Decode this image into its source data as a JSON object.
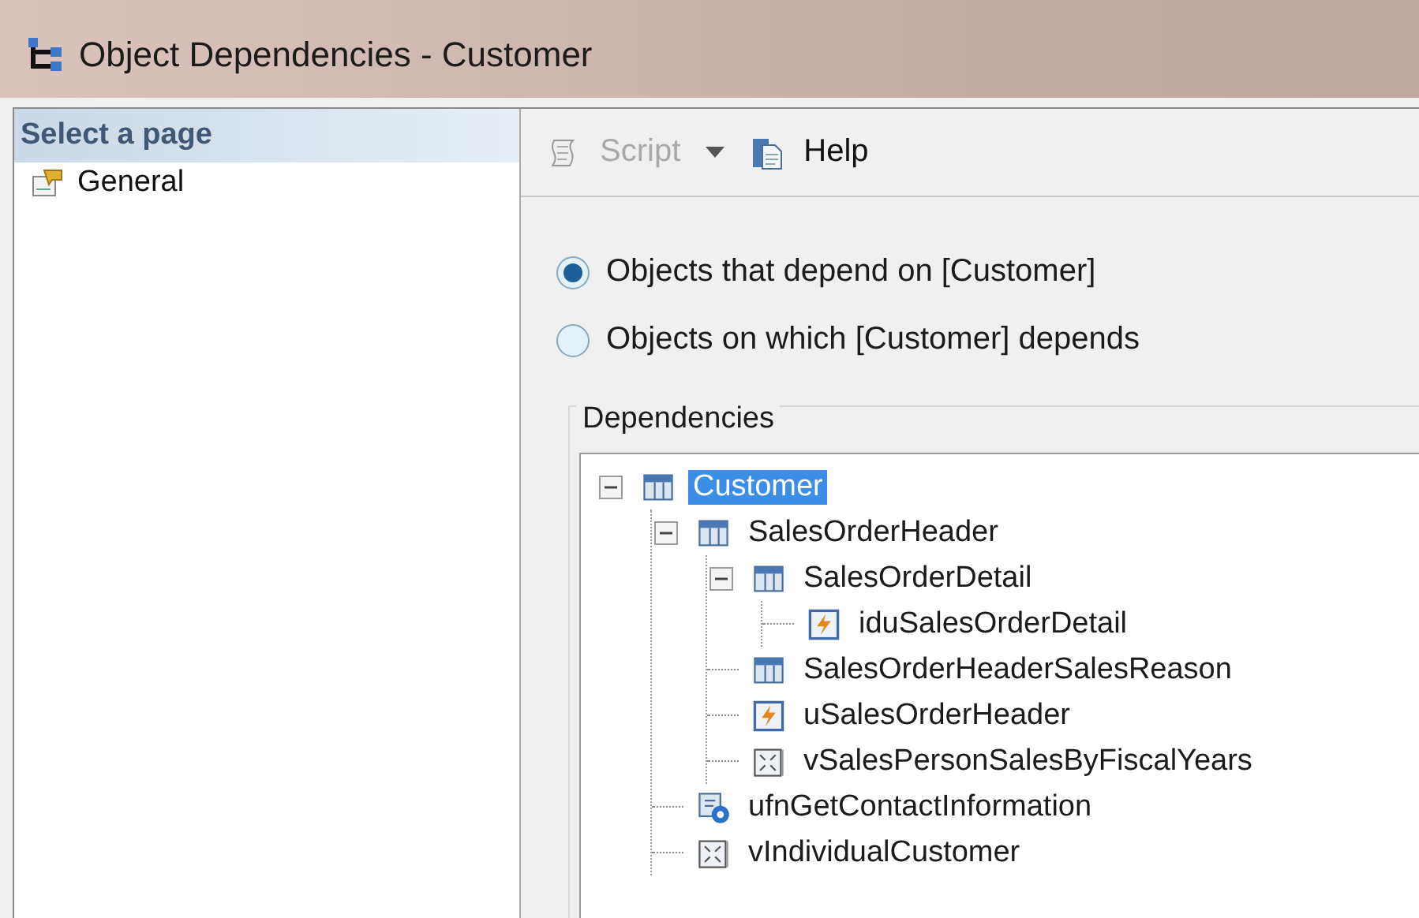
{
  "window": {
    "title": "Object Dependencies - Customer"
  },
  "sidebar": {
    "header": "Select a page",
    "items": [
      {
        "label": "General",
        "selected": false
      }
    ]
  },
  "toolbar": [
    {
      "label": "Script",
      "kind": "script",
      "disabled": true,
      "dropdown": true
    },
    {
      "label": "Help",
      "kind": "help",
      "disabled": false,
      "dropdown": false
    }
  ],
  "options": [
    {
      "label": "Objects that depend on [Customer]",
      "selected": true
    },
    {
      "label": "Objects on which [Customer] depends",
      "selected": false
    }
  ],
  "dependencies": {
    "title": "Dependencies",
    "tree": [
      {
        "label": "Customer",
        "kind": "table",
        "selected": true,
        "expanded": true,
        "children": [
          {
            "label": "SalesOrderHeader",
            "kind": "table",
            "selected": false,
            "expanded": true,
            "children": [
              {
                "label": "SalesOrderDetail",
                "kind": "table",
                "selected": false,
                "expanded": true,
                "children": [
                  {
                    "label": "iduSalesOrderDetail",
                    "kind": "trigger",
                    "selected": false
                  }
                ]
              },
              {
                "label": "SalesOrderHeaderSalesReason",
                "kind": "table",
                "selected": false
              },
              {
                "label": "uSalesOrderHeader",
                "kind": "trigger",
                "selected": false
              },
              {
                "label": "vSalesPersonSalesByFiscalYears",
                "kind": "view",
                "selected": false
              }
            ]
          },
          {
            "label": "ufnGetContactInformation",
            "kind": "function",
            "selected": false
          },
          {
            "label": "vIndividualCustomer",
            "kind": "view",
            "selected": false
          }
        ]
      }
    ]
  }
}
